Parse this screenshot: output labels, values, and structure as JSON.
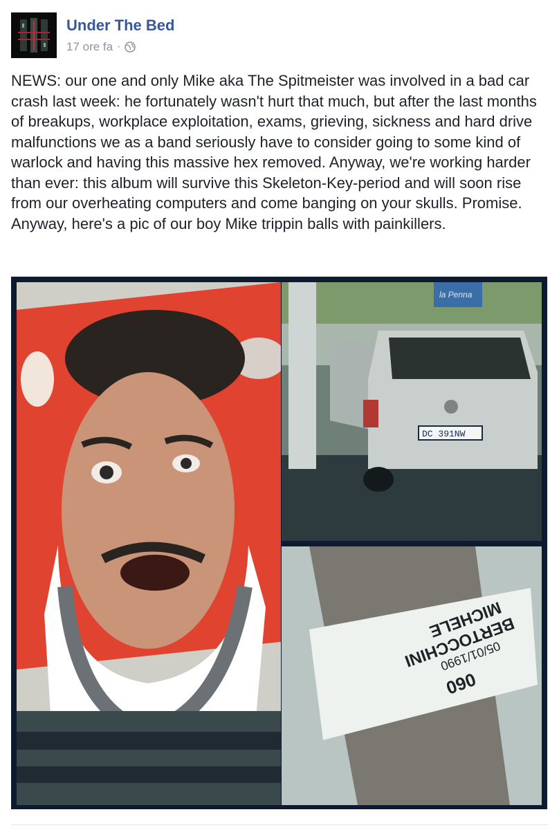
{
  "post": {
    "page_name": "Under The Bed",
    "timestamp": "17 ore fa",
    "separator": "·",
    "audience_icon": "globe-icon",
    "text": "NEWS: our one and only Mike aka The Spitmeister was involved in a bad car crash last week: he fortunately wasn't hurt that much, but after the last months of breakups, workplace exploitation, exams, grieving, sickness and hard drive malfunctions we as a band seriously have to consider going to some kind of warlock and having this massive hex removed. Anyway, we're working harder than ever: this album will survive this Skeleton-Key-period and will soon rise from our overheating computers and come banging on your skulls. Promise. Anyway, here's a pic of our boy Mike trippin balls with painkillers."
  },
  "photos": {
    "car": {
      "plate": "DC 391NW",
      "sign": "la Penna"
    },
    "wristband": {
      "code": "060",
      "date": "05/01/1990",
      "surname": "BERTOCCHINI",
      "name": "MICHELE"
    }
  },
  "colors": {
    "link": "#365899",
    "meta": "#90949c",
    "text": "#1d2129",
    "collage_border": "#0d1a30"
  }
}
